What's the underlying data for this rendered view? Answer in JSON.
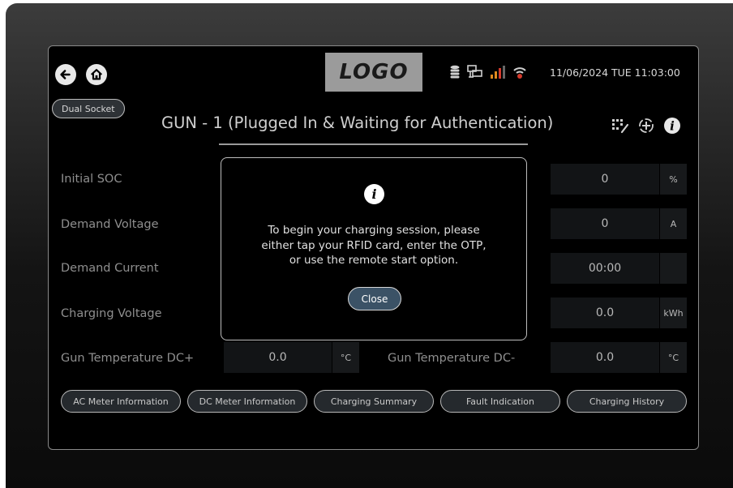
{
  "header": {
    "logo_text": "LOGO",
    "datetime": "11/06/2024 TUE 11:03:00",
    "back_icon": "arrow-left-icon",
    "home_icon": "home-icon",
    "status_icons": [
      "database-icon",
      "network-icon",
      "signal-bars-icon",
      "wifi-off-icon"
    ]
  },
  "socket_badge": "Dual Socket",
  "gun_title": "GUN - 1 (Plugged In & Waiting for Authentication)",
  "title_icons": [
    "qr-code-icon",
    "remote-start-icon",
    "info-icon"
  ],
  "rows": [
    {
      "label": "Initial SOC",
      "value": "0",
      "unit": "%"
    },
    {
      "label": "Demand Voltage",
      "value": "0",
      "unit": "A"
    },
    {
      "label": "Demand Current",
      "value": "00:00",
      "unit": ""
    },
    {
      "label": "Charging Voltage",
      "value": "0.0",
      "unit": "kWh"
    }
  ],
  "temperature": {
    "dc_plus_label": "Gun Temperature DC+",
    "dc_plus_value": "0.0",
    "dc_plus_unit": "°C",
    "dc_minus_label": "Gun Temperature DC-",
    "dc_minus_value": "0.0",
    "dc_minus_unit": "°C"
  },
  "bottom_buttons": [
    "AC Meter Information",
    "DC Meter Information",
    "Charging Summary",
    "Fault Indication",
    "Charging History"
  ],
  "modal": {
    "icon": "info-icon",
    "message_lines": [
      "To begin your charging session, please",
      "either tap your RFID card, enter the OTP,",
      "or use the remote start option."
    ],
    "close_label": "Close"
  },
  "colors": {
    "screen_bg": "#000000",
    "close_button_bg": "#3b5266",
    "signal_alert": "#d33a2c",
    "signal_bars": "#e08a1e"
  }
}
